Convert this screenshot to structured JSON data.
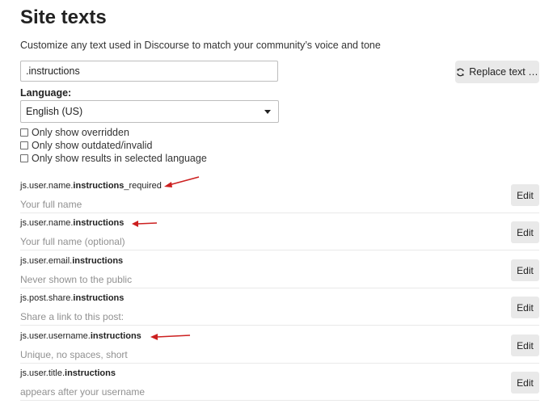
{
  "page": {
    "title": "Site texts",
    "subtitle": "Customize any text used in Discourse to match your community’s voice and tone"
  },
  "search": {
    "value": ".instructions"
  },
  "replace_button": {
    "label": "Replace text …",
    "icon": "refresh-icon"
  },
  "language": {
    "label": "Language:",
    "selected": "English (US)"
  },
  "filters": [
    {
      "label": "Only show overridden",
      "checked": false
    },
    {
      "label": "Only show outdated/invalid",
      "checked": false
    },
    {
      "label": "Only show results in selected language",
      "checked": false
    }
  ],
  "results": [
    {
      "key_prefix": "js.user.name.",
      "key_match": "instructions",
      "key_suffix": "_required",
      "value": "Your full name",
      "edit_label": "Edit"
    },
    {
      "key_prefix": "js.user.name.",
      "key_match": "instructions",
      "key_suffix": "",
      "value": "Your full name (optional)",
      "edit_label": "Edit"
    },
    {
      "key_prefix": "js.user.email.",
      "key_match": "instructions",
      "key_suffix": "",
      "value": "Never shown to the public",
      "edit_label": "Edit"
    },
    {
      "key_prefix": "js.post.share.",
      "key_match": "instructions",
      "key_suffix": "",
      "value": "Share a link to this post:",
      "edit_label": "Edit"
    },
    {
      "key_prefix": "js.user.username.",
      "key_match": "instructions",
      "key_suffix": "",
      "value": "Unique, no spaces, short",
      "edit_label": "Edit"
    },
    {
      "key_prefix": "js.user.title.",
      "key_match": "instructions",
      "key_suffix": "",
      "value": "appears after your username",
      "edit_label": "Edit"
    }
  ],
  "annotation_color": "#cc1f1f"
}
